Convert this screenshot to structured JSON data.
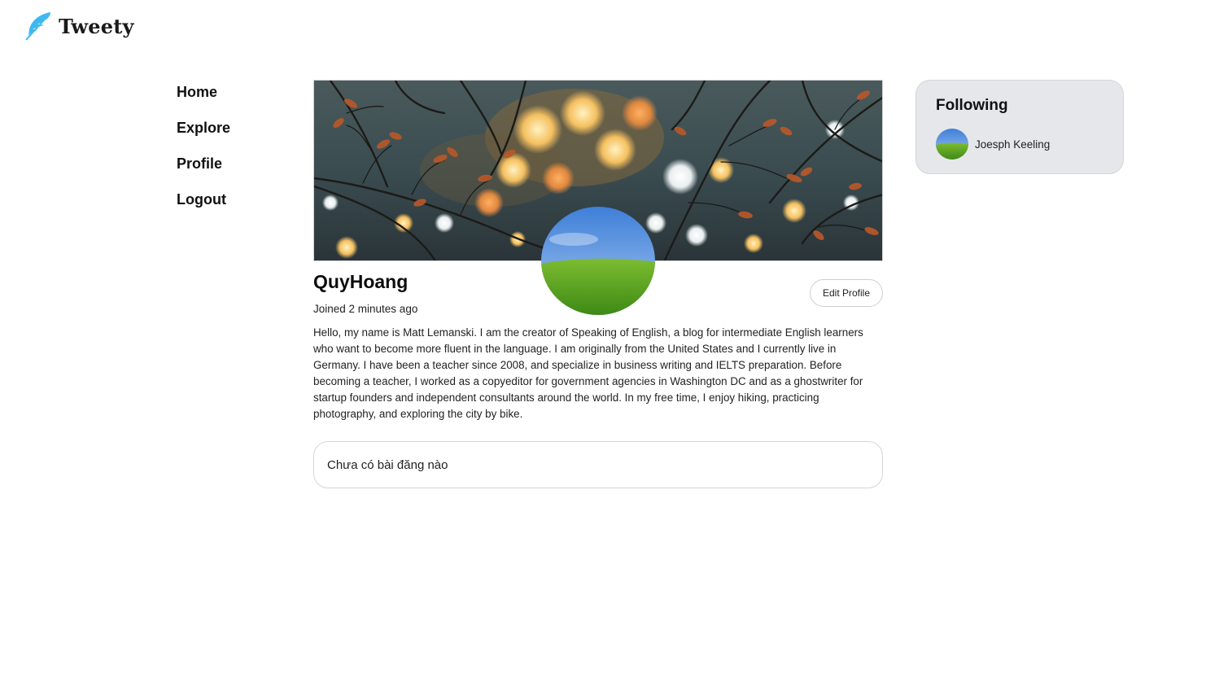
{
  "app": {
    "name": "Tweety",
    "logo_icon": "feather-icon",
    "accent_color": "#3fb8f0"
  },
  "nav": {
    "items": [
      {
        "label": "Home"
      },
      {
        "label": "Explore"
      },
      {
        "label": "Profile"
      },
      {
        "label": "Logout"
      }
    ]
  },
  "profile": {
    "username": "QuyHoang",
    "joined": "Joined 2 minutes ago",
    "edit_label": "Edit Profile",
    "bio": "Hello, my name is Matt Lemanski. I am the creator of Speaking of English, a blog for intermediate English learners who want to become more fluent in the language. I am originally from the United States and I currently live in Germany. I have been a teacher since 2008, and specialize in business writing and IELTS preparation. Before becoming a teacher, I worked as a copyeditor for government agencies in Washington DC and as a ghostwriter for startup founders and independent consultants around the world. In my free time, I enjoy hiking, practicing photography, and exploring the city by bike.",
    "posts_empty": "Chưa có bài đăng nào"
  },
  "following": {
    "title": "Following",
    "users": [
      {
        "name": "Joesph Keeling"
      }
    ]
  }
}
